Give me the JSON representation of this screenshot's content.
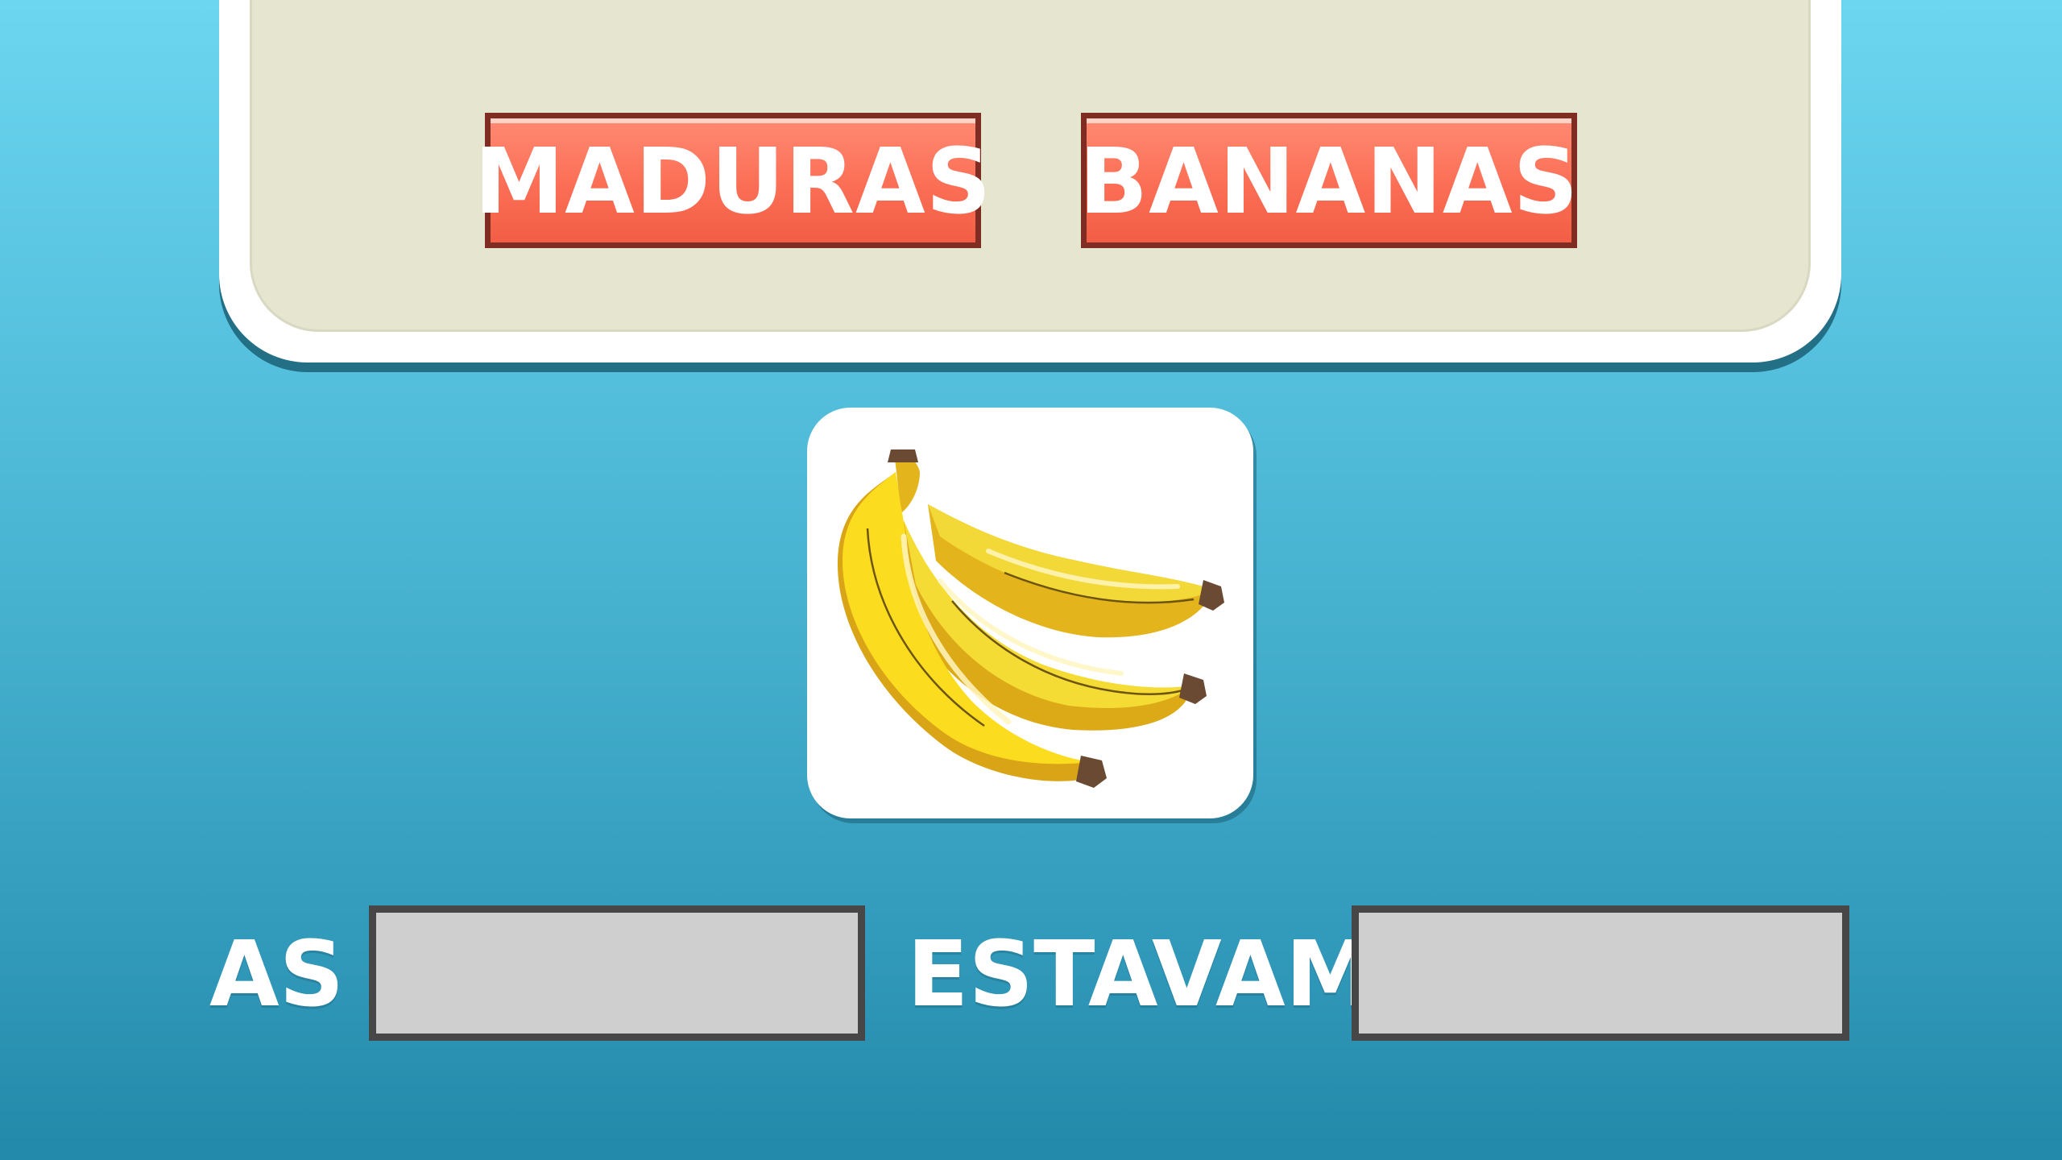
{
  "word_bank": {
    "tiles": [
      {
        "label": "MADURAS"
      },
      {
        "label": "BANANAS"
      }
    ]
  },
  "picture": {
    "icon": "banana-bunch-icon"
  },
  "sentence": {
    "word_1": "AS",
    "blank_1": "",
    "word_2": "ESTAVAM",
    "blank_2": ""
  },
  "colors": {
    "background_top": "#6cd6f0",
    "background_bottom": "#2389aa",
    "tray": "#e6e5cf",
    "tile": "#fb6e55",
    "tile_border": "#7f2d22",
    "slot": "#cfcfcf",
    "slot_border": "#474747"
  }
}
